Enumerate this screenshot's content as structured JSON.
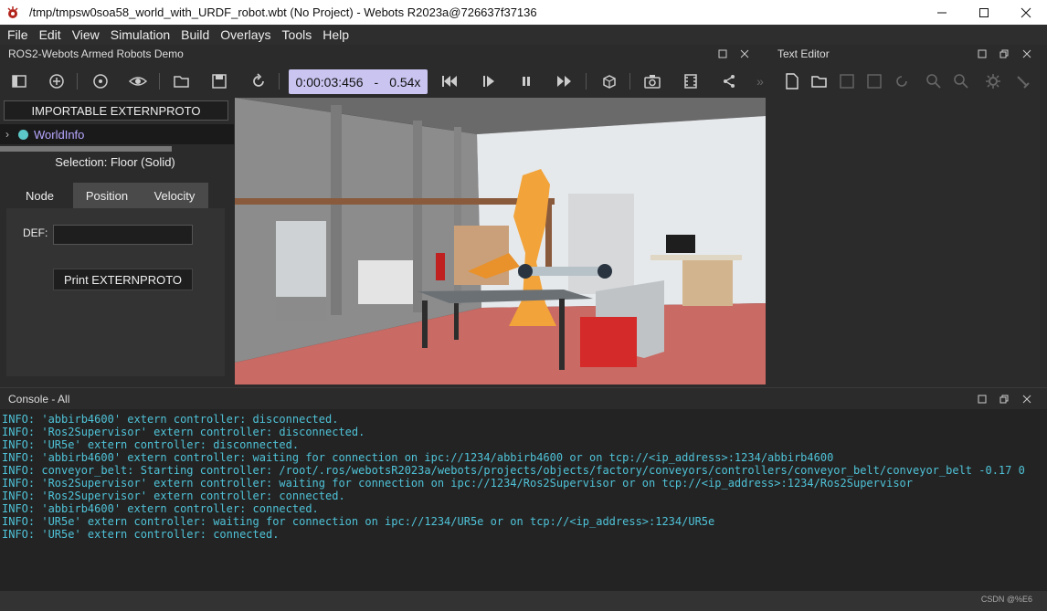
{
  "window": {
    "title": "/tmp/tmpsw0soa58_world_with_URDF_robot.wbt (No Project) - Webots R2023a@726637f37136",
    "minimize": "—",
    "maximize": "☐",
    "close": "✕"
  },
  "menu": [
    {
      "label": "File"
    },
    {
      "label": "Edit"
    },
    {
      "label": "View"
    },
    {
      "label": "Simulation"
    },
    {
      "label": "Build"
    },
    {
      "label": "Overlays"
    },
    {
      "label": "Tools"
    },
    {
      "label": "Help"
    }
  ],
  "sim_dock": {
    "title": "ROS2-Webots Armed Robots Demo"
  },
  "toolbar": {
    "time": "0:00:03:456",
    "separator": "-",
    "speed": "0.54x",
    "overflow": "»",
    "accent": "#c9c4f0"
  },
  "scene_tree": {
    "proto_button": "IMPORTABLE EXTERNPROTO",
    "root_item": "WorldInfo",
    "selection": "Selection: Floor (Solid)",
    "tabs": [
      "Node",
      "Position",
      "Velocity"
    ],
    "def_label": "DEF:",
    "def_value": "",
    "print_button": "Print EXTERNPROTO"
  },
  "editor": {
    "title": "Text Editor"
  },
  "console": {
    "title": "Console - All",
    "lines": [
      "INFO: 'abbirb4600' extern controller: disconnected.",
      "INFO: 'Ros2Supervisor' extern controller: disconnected.",
      "INFO: 'UR5e' extern controller: disconnected.",
      "INFO: 'abbirb4600' extern controller: waiting for connection on ipc://1234/abbirb4600 or on tcp://<ip_address>:1234/abbirb4600",
      "INFO: conveyor_belt: Starting controller: /root/.ros/webotsR2023a/webots/projects/objects/factory/conveyors/controllers/conveyor_belt/conveyor_belt -0.17 0",
      "INFO: 'Ros2Supervisor' extern controller: waiting for connection on ipc://1234/Ros2Supervisor or on tcp://<ip_address>:1234/Ros2Supervisor",
      "INFO: 'Ros2Supervisor' extern controller: connected.",
      "INFO: 'abbirb4600' extern controller: connected.",
      "INFO: 'UR5e' extern controller: waiting for connection on ipc://1234/UR5e or on tcp://<ip_address>:1234/UR5e",
      "INFO: 'UR5e' extern controller: connected."
    ],
    "text_color": "#4fc3d8"
  },
  "watermark": "CSDN @%E6"
}
